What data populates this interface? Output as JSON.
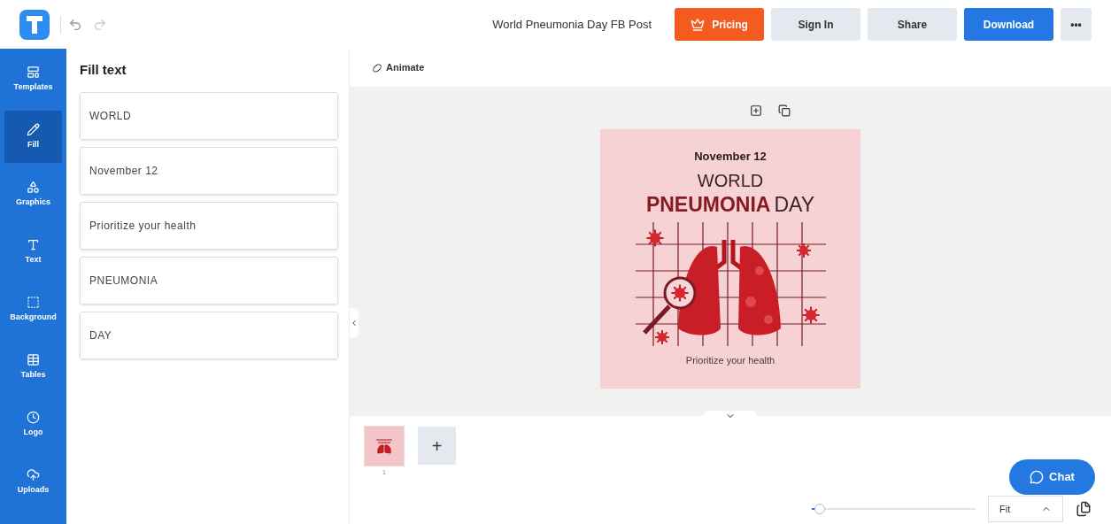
{
  "header": {
    "document_title": "World Pneumonia Day FB Post",
    "buttons": [
      {
        "kind": "pricing",
        "label": "Pricing"
      },
      {
        "kind": "plain",
        "label": "Sign In"
      },
      {
        "kind": "plain",
        "label": "Share"
      },
      {
        "kind": "primary",
        "label": "Download"
      },
      {
        "kind": "more",
        "label": "•••"
      }
    ]
  },
  "sidebar": {
    "items": [
      {
        "label": "Templates",
        "selected": false
      },
      {
        "label": "Fill",
        "selected": true
      },
      {
        "label": "Graphics",
        "selected": false
      },
      {
        "label": "Text",
        "selected": false
      },
      {
        "label": "Background",
        "selected": false
      },
      {
        "label": "Tables",
        "selected": false
      },
      {
        "label": "Logo",
        "selected": false
      },
      {
        "label": "Uploads",
        "selected": false
      }
    ]
  },
  "panel": {
    "title": "Fill text",
    "fields": [
      "WORLD",
      "November 12",
      "Prioritize your health",
      "PNEUMONIA",
      "DAY"
    ]
  },
  "toolbar": {
    "animate": "Animate"
  },
  "design": {
    "date": "November 12",
    "line1": "WORLD",
    "line2_bold": "PNEUMONIA",
    "line2_rest": "DAY",
    "tagline": "Prioritize your health"
  },
  "pages": [
    {
      "number": "1",
      "selected": true
    }
  ],
  "add_page": "+",
  "chat": "Chat",
  "zoom": {
    "level": 0.05,
    "value": "Fit"
  }
}
